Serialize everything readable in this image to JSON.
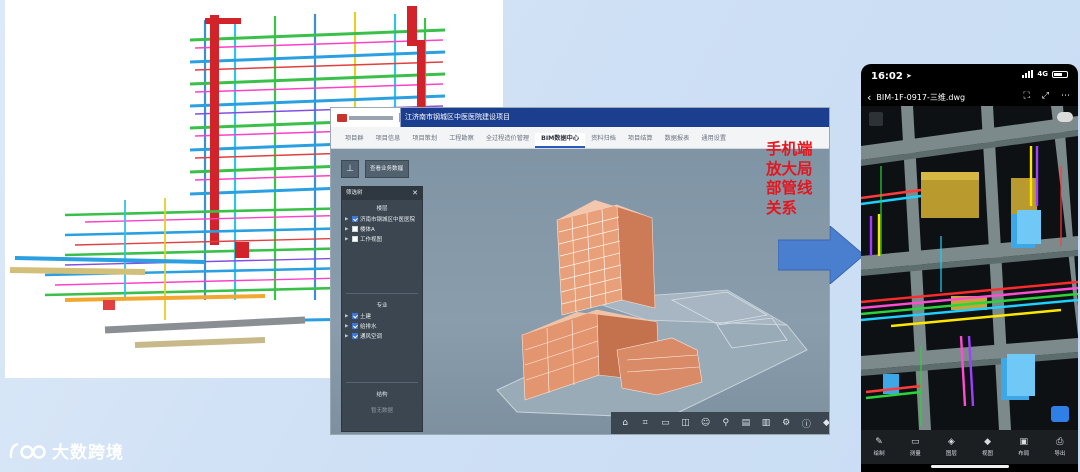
{
  "web_app": {
    "project_title": "江济南市钢城区中医医院建设项目",
    "nav_tabs": [
      {
        "label": "项目群",
        "active": false
      },
      {
        "label": "项目信息",
        "active": false
      },
      {
        "label": "项目策划",
        "active": false
      },
      {
        "label": "工程勘察",
        "active": false
      },
      {
        "label": "全过程造价管理",
        "active": false
      },
      {
        "label": "BIM数据中心",
        "active": true
      },
      {
        "label": "资料归档",
        "active": false
      },
      {
        "label": "项目结算",
        "active": false
      },
      {
        "label": "数据报表",
        "active": false
      },
      {
        "label": "通用设置",
        "active": false
      }
    ],
    "dataset_select": "查看业务数据",
    "filter_panel": {
      "title": "筛选树",
      "floor_section": "楼层",
      "floor_items": [
        {
          "label": "济南市钢城区中医医院",
          "checked": true
        },
        {
          "label": "楼体A",
          "checked": false
        },
        {
          "label": "工作视图",
          "checked": false
        }
      ],
      "discipline_section": "专业",
      "discipline_items": [
        {
          "label": "土建",
          "checked": true
        },
        {
          "label": "给排水",
          "checked": true
        },
        {
          "label": "通风空调",
          "checked": true
        }
      ],
      "structure_section": "结构",
      "empty_text": "暂无数据"
    },
    "toolbar_icons": [
      "home-icon",
      "crop-icon",
      "measure-icon",
      "section-icon",
      "person-icon",
      "pin-icon",
      "layers-icon",
      "chart-icon",
      "settings-icon",
      "info-icon",
      "cube-icon",
      "shape-icon",
      "share-icon",
      "fullscreen-icon"
    ]
  },
  "caption": {
    "line1": "手机端",
    "line2": "放大局",
    "line3": "部管线",
    "line4": "关系"
  },
  "phone": {
    "time": "16:02",
    "network": "4G",
    "file_name": "BIM-1F-0917-三维.dwg",
    "tools": [
      {
        "label": "绘制",
        "icon": "draw-icon"
      },
      {
        "label": "测量",
        "icon": "ruler-icon"
      },
      {
        "label": "图层",
        "icon": "layers-icon"
      },
      {
        "label": "视图",
        "icon": "cube-icon"
      },
      {
        "label": "布局",
        "icon": "layout-icon"
      },
      {
        "label": "导出",
        "icon": "print-icon"
      }
    ]
  },
  "watermark": {
    "text": "大数跨境"
  }
}
